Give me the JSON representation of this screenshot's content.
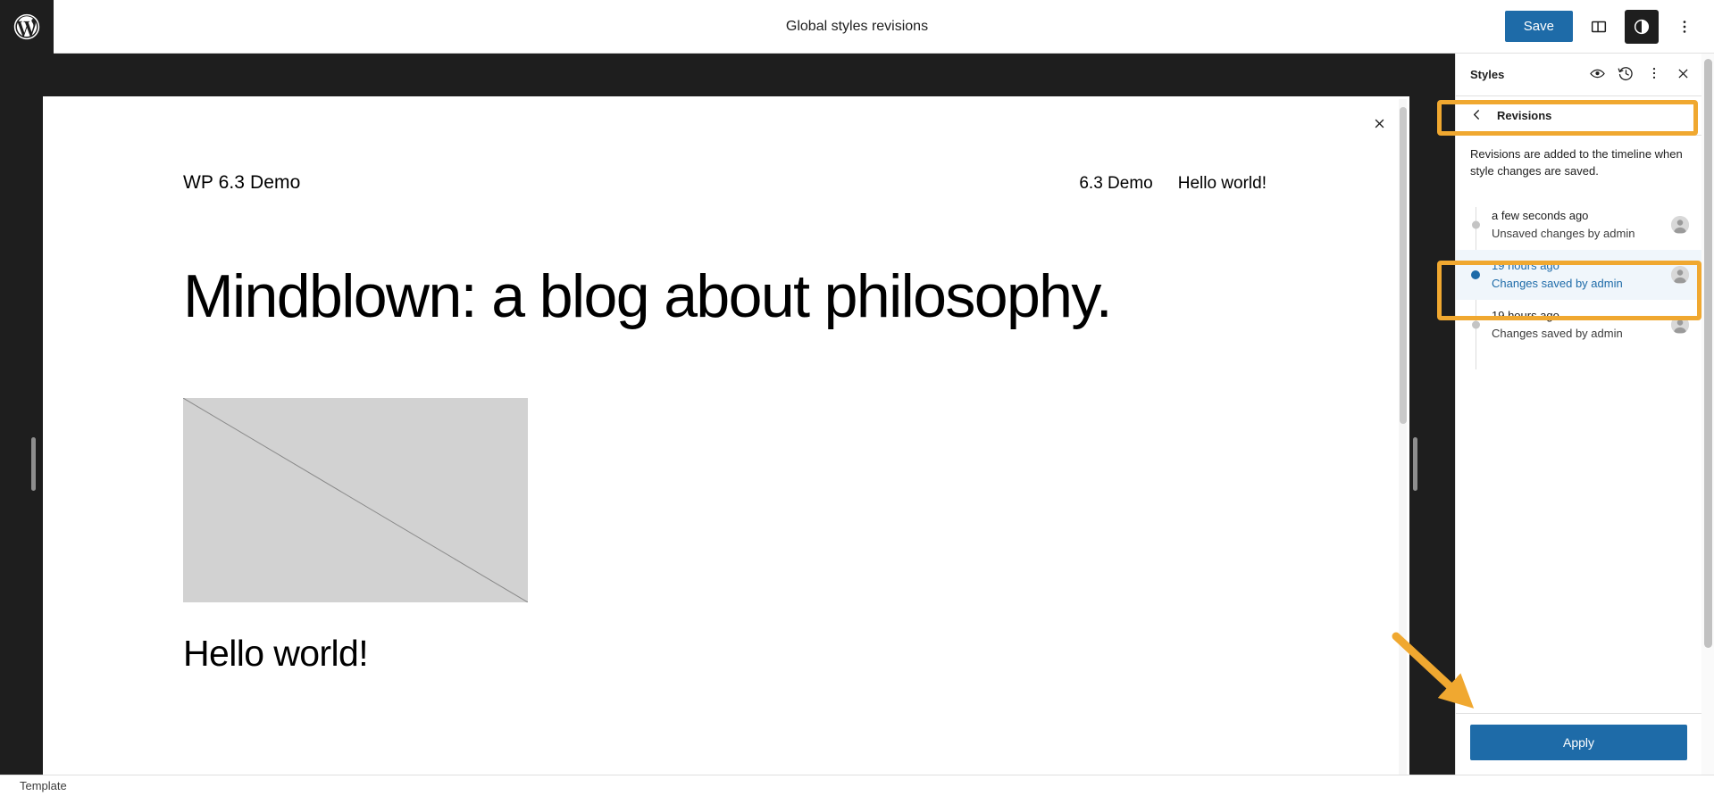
{
  "topbar": {
    "logo_icon": "wordpress-logo-icon",
    "title": "Global styles revisions",
    "save_label": "Save",
    "sidebar_toggle_icon": "panel-layout-icon",
    "styles_toggle_icon": "contrast-circle-icon",
    "options_icon": "three-dots-vertical-icon"
  },
  "canvas": {
    "close_icon": "close-x-icon",
    "site_title": "WP 6.3 Demo",
    "nav_items": [
      "6.3 Demo",
      "Hello world!"
    ],
    "post_title": "Mindblown: a blog about philosophy.",
    "post_image_alt": "image-placeholder",
    "post_subtitle": "Hello world!",
    "resize_handle_left": "resize-handle-left",
    "resize_handle_right": "resize-handle-right"
  },
  "sidebar": {
    "header": {
      "title": "Styles",
      "style_book_icon": "eye-icon",
      "revisions_icon": "clock-history-icon",
      "more_icon": "three-dots-vertical-icon",
      "close_icon": "close-x-icon"
    },
    "revisions_panel": {
      "back_icon": "chevron-left-icon",
      "title": "Revisions",
      "description": "Revisions are added to the timeline when style changes are saved.",
      "items": [
        {
          "time": "a few seconds ago",
          "meta": "Unsaved changes by admin",
          "selected": false,
          "avatar_icon": "user-avatar-icon"
        },
        {
          "time": "19 hours ago",
          "meta": "Changes saved by admin",
          "selected": true,
          "avatar_icon": "user-avatar-icon"
        },
        {
          "time": "19 hours ago",
          "meta": "Changes saved by admin",
          "selected": false,
          "avatar_icon": "user-avatar-icon"
        }
      ],
      "apply_label": "Apply"
    }
  },
  "bottombar": {
    "label": "Template"
  },
  "annotations": {
    "highlight_color": "#f0a830",
    "boxes": [
      "revisions-panel-header",
      "selected-revision-item"
    ],
    "arrow": "points-to-apply-button"
  },
  "colors": {
    "accent_blue": "#1e6ba8",
    "dark_chrome": "#1e1e1e",
    "selected_row_bg": "#f0f6fb",
    "annotation_orange": "#f0a830"
  }
}
